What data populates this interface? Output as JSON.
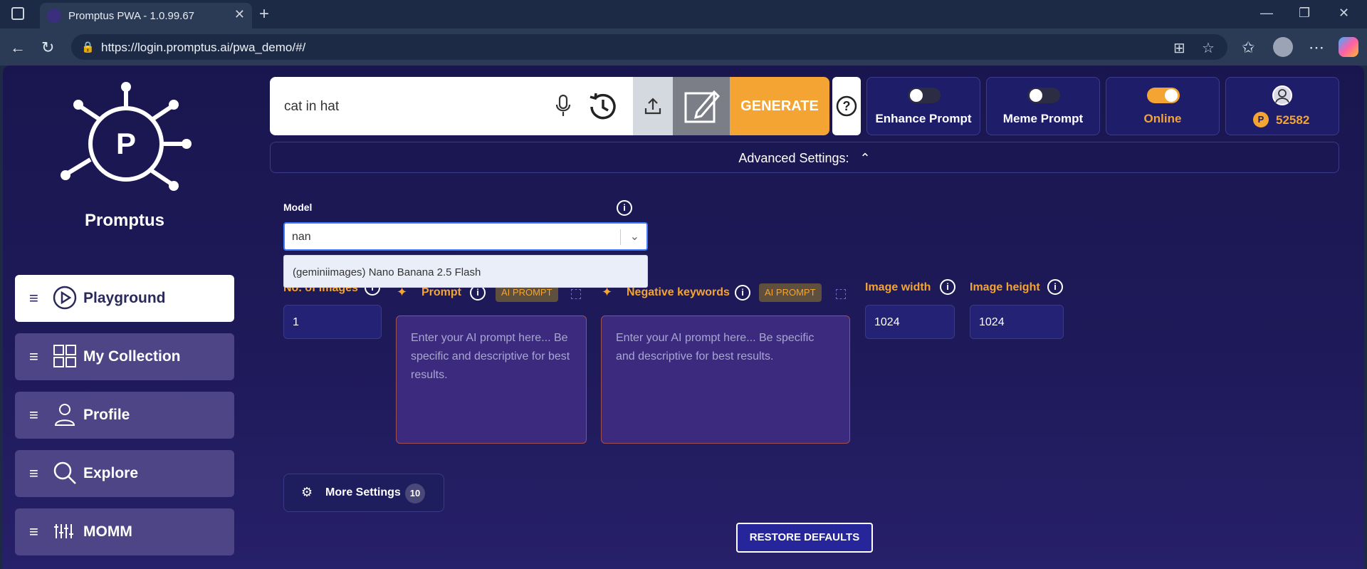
{
  "browser": {
    "tab_title": "Promptus PWA - 1.0.99.67",
    "url": "https://login.promptus.ai/pwa_demo/#/"
  },
  "brand": {
    "name": "Promptus"
  },
  "sidebar": {
    "items": [
      {
        "label": "Playground",
        "icon": "play-icon",
        "active": true
      },
      {
        "label": "My Collection",
        "icon": "grid-icon",
        "active": false
      },
      {
        "label": "Profile",
        "icon": "user-icon",
        "active": false
      },
      {
        "label": "Explore",
        "icon": "search-icon",
        "active": false
      },
      {
        "label": "MOMM",
        "icon": "mixer-icon",
        "active": false
      }
    ]
  },
  "prompt": {
    "value": "cat in hat",
    "generate_label": "GENERATE"
  },
  "toggles": {
    "enhance": {
      "label": "Enhance Prompt",
      "on": false
    },
    "meme": {
      "label": "Meme Prompt",
      "on": false
    },
    "online": {
      "label": "Online",
      "on": true
    }
  },
  "credits": {
    "value": "52582",
    "coin_glyph": "P"
  },
  "advanced": {
    "label": "Advanced Settings:"
  },
  "model": {
    "label": "Model",
    "input_value": "nan",
    "options": [
      "(geminiimages) Nano Banana 2.5 Flash"
    ]
  },
  "num_images": {
    "label": "No. of images",
    "value": "1"
  },
  "prompt_field": {
    "label": "Prompt",
    "pill": "AI PROMPT",
    "placeholder": "Enter your AI prompt here... Be specific and descriptive for best results."
  },
  "negative_field": {
    "label": "Negative keywords",
    "pill": "AI PROMPT",
    "placeholder": "Enter your AI prompt here... Be specific and descriptive for best results."
  },
  "image_width": {
    "label": "Image width",
    "value": "1024"
  },
  "image_height": {
    "label": "Image height",
    "value": "1024"
  },
  "more_settings": {
    "label": "More Settings",
    "count": "10"
  },
  "restore": {
    "label": "RESTORE DEFAULTS"
  },
  "colors": {
    "accent": "#f4a432",
    "panel": "#1f1e6e",
    "active_item": "#ffffff"
  }
}
